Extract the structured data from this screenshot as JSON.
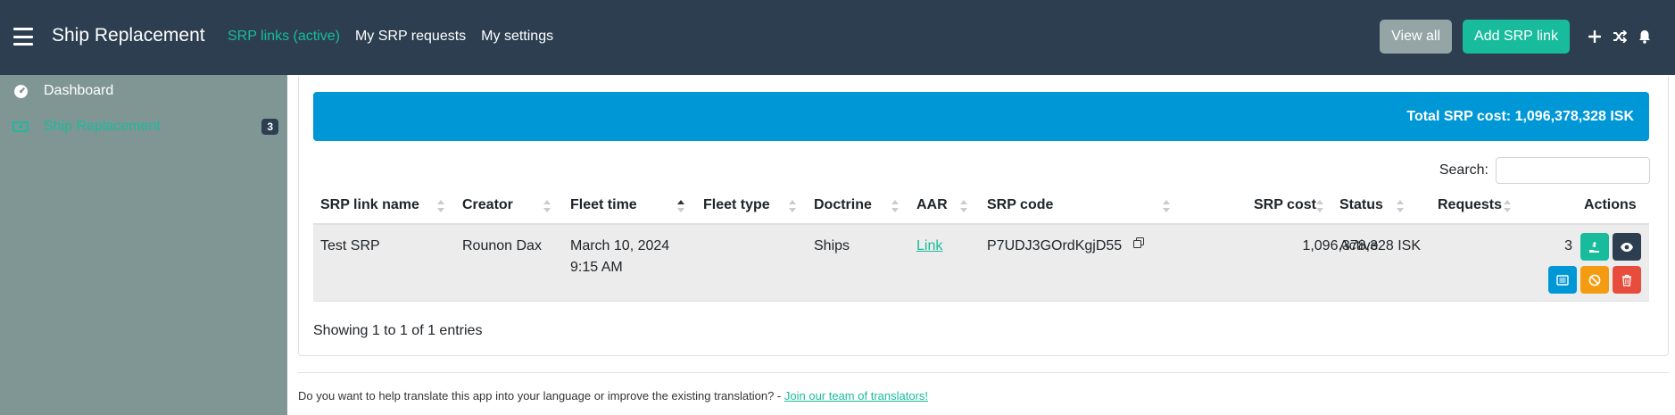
{
  "app": {
    "title": "Ship Replacement"
  },
  "topnav": [
    {
      "label": "SRP links (active)",
      "active": true
    },
    {
      "label": "My SRP requests",
      "active": false
    },
    {
      "label": "My settings",
      "active": false
    }
  ],
  "buttons": {
    "view_all": "View all",
    "add_srp_link": "Add SRP link"
  },
  "sidebar": {
    "items": [
      {
        "label": "Dashboard",
        "icon": "dashboard-icon"
      },
      {
        "label": "Ship Replacement",
        "icon": "money-icon",
        "badge": "3"
      }
    ]
  },
  "summary": {
    "total_srp_cost": "Total SRP cost: 1,096,378,328 ISK"
  },
  "search": {
    "label": "Search:",
    "placeholder": "",
    "value": ""
  },
  "table": {
    "columns": [
      "SRP link name",
      "Creator",
      "Fleet time",
      "Fleet type",
      "Doctrine",
      "AAR",
      "SRP code",
      "SRP cost",
      "Status",
      "Requests",
      "Actions"
    ],
    "rows": [
      {
        "srp_link_name": "Test SRP",
        "creator": "Rounon Dax",
        "fleet_date": "March 10, 2024",
        "fleet_clock": "9:15 AM",
        "fleet_type": "",
        "doctrine": "Ships",
        "aar": "Link",
        "srp_code": "P7UDJ3GOrdKgjD55",
        "srp_cost": "1,096,378,328 ISK",
        "status": "Active",
        "requests": "3"
      }
    ]
  },
  "pagination": {
    "info": "Showing 1 to 1 of 1 entries"
  },
  "footer": {
    "text": "Do you want to help translate this app into your language or improve the existing translation? - ",
    "link": "Join our team of translators!"
  },
  "colors": {
    "navbar": "#2c3e50",
    "accent": "#18bc9c",
    "sidebar": "#7f9694",
    "banner": "#0097d7",
    "danger": "#e74c3c",
    "warning": "#f39c12",
    "info": "#3498db"
  }
}
